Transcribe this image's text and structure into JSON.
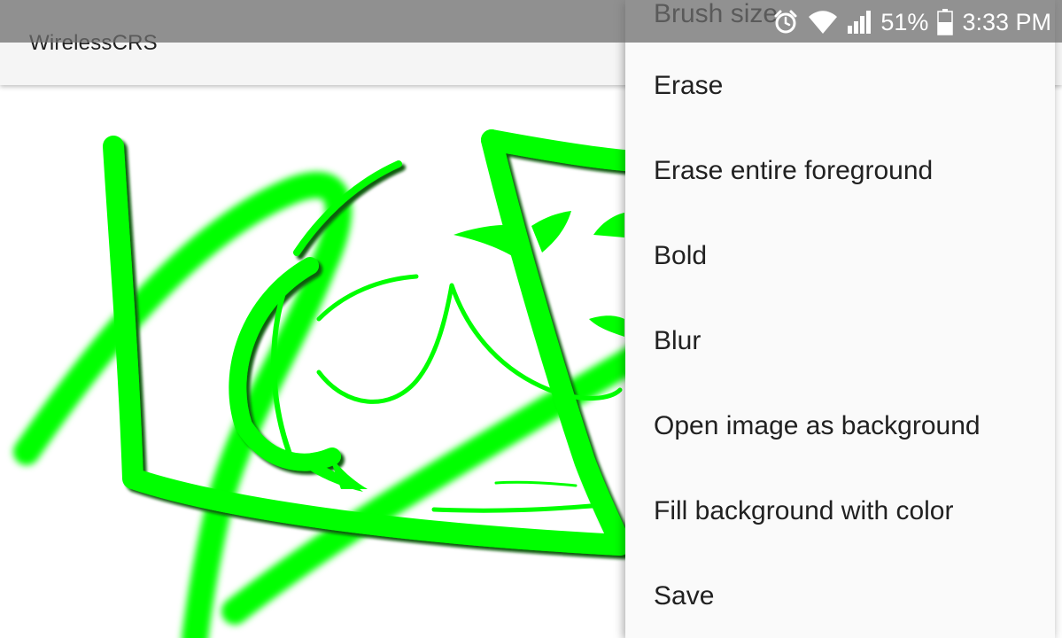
{
  "app": {
    "title": "WirelessCRS"
  },
  "status_bar": {
    "battery_percent": "51%",
    "time": "3:33 PM",
    "icons": [
      "alarm-icon",
      "wifi-icon",
      "cell-signal-icon",
      "battery-icon"
    ]
  },
  "canvas": {
    "brush_color": "#00ff00",
    "background_color": "#ffffff"
  },
  "menu": {
    "items": [
      {
        "label": "Brush size"
      },
      {
        "label": "Erase"
      },
      {
        "label": "Erase entire foreground"
      },
      {
        "label": "Bold"
      },
      {
        "label": "Blur"
      },
      {
        "label": "Open image as background"
      },
      {
        "label": "Fill background with color"
      },
      {
        "label": "Save"
      }
    ]
  }
}
